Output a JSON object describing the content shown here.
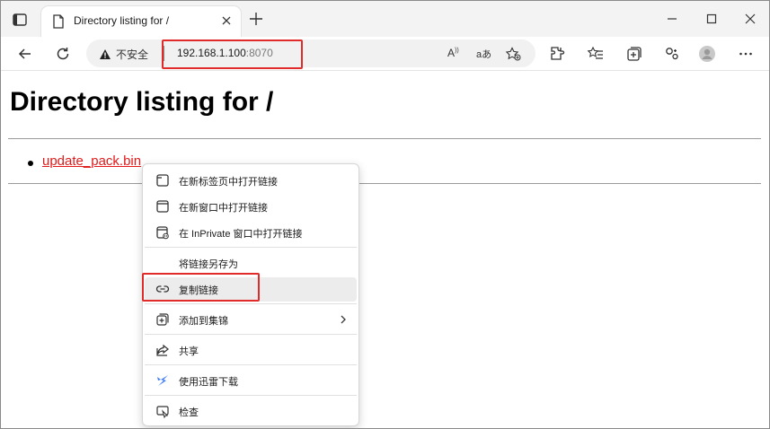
{
  "browser": {
    "tab_title": "Directory listing for /",
    "security_label": "不安全",
    "url_host": "192.168.1.100",
    "url_port": ":8070",
    "read_aloud_label": "A",
    "translate_label": "aあ"
  },
  "page": {
    "title": "Directory listing for /",
    "files": [
      "update_pack.bin"
    ]
  },
  "context_menu": {
    "items": [
      {
        "label": "在新标签页中打开链接",
        "icon": "new-tab-icon"
      },
      {
        "label": "在新窗口中打开链接",
        "icon": "new-window-icon"
      },
      {
        "label": "在 InPrivate 窗口中打开链接",
        "icon": "inprivate-icon"
      },
      {
        "label": "将链接另存为",
        "icon": ""
      },
      {
        "label": "复制链接",
        "icon": "link-icon"
      },
      {
        "label": "添加到集锦",
        "icon": "collections-icon"
      },
      {
        "label": "共享",
        "icon": "share-icon"
      },
      {
        "label": "使用迅雷下载",
        "icon": "thunder-icon"
      },
      {
        "label": "检查",
        "icon": "inspect-icon"
      }
    ]
  },
  "colors": {
    "highlight": "#e12b2b",
    "link": "#e11b1b",
    "thunder": "#3d7bf5"
  }
}
